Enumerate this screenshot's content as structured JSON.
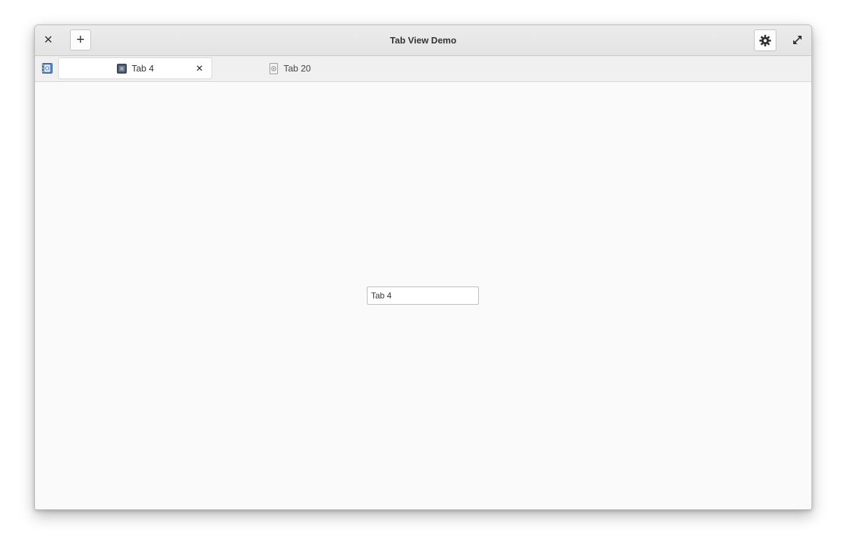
{
  "window": {
    "title": "Tab View Demo"
  },
  "header": {
    "close_icon": "close-icon",
    "add_label": "+",
    "settings_icon": "gear-icon",
    "maximize_icon": "maximize-icon"
  },
  "tabbar": {
    "tabs": [
      {
        "label": "Tab 4",
        "active": true,
        "icon": "image-icon",
        "close_icon": "close-icon"
      },
      {
        "label": "Tab 20",
        "active": false,
        "icon": "document-icon"
      }
    ]
  },
  "content": {
    "entry_value": "Tab 4"
  },
  "colors": {
    "header_bg": "#e6e6e6",
    "tabbar_bg": "#f0f0f0",
    "content_bg": "#fafafa",
    "active_tab_bg": "#ffffff"
  }
}
